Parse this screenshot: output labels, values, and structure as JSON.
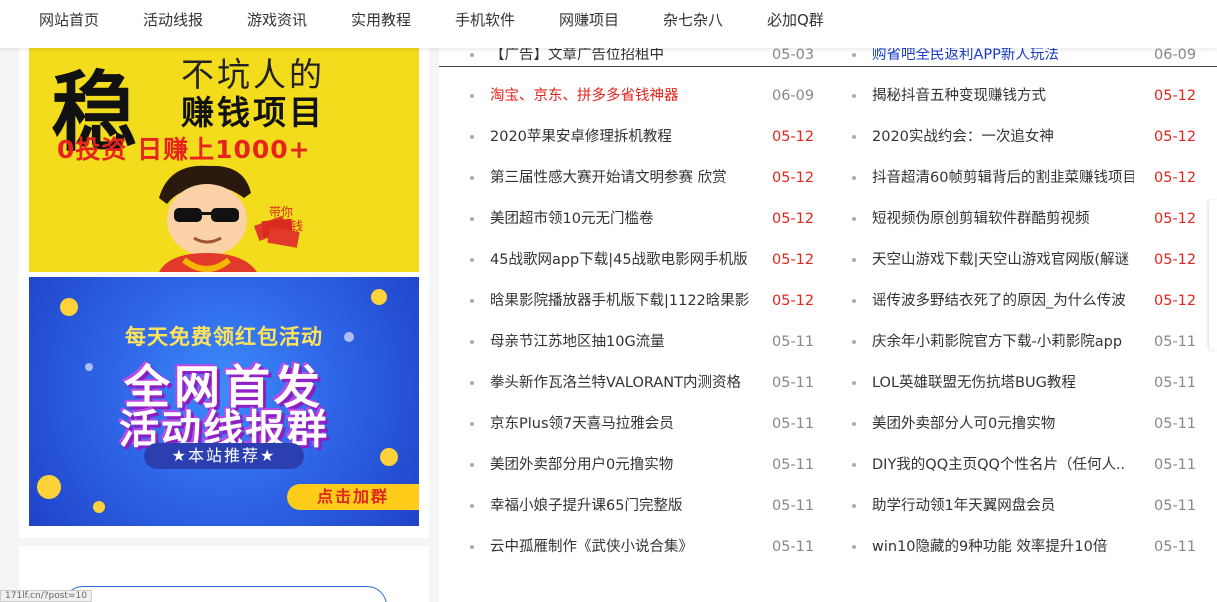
{
  "nav": {
    "items": [
      "网站首页",
      "活动线报",
      "游戏资讯",
      "实用教程",
      "手机软件",
      "网赚项目",
      "杂七杂八",
      "必加Q群"
    ]
  },
  "banner1": {
    "big_char": "稳",
    "line1": "不坑人的",
    "line2": "赚钱项目",
    "line3": "0投资 日赚上1000+"
  },
  "banner2": {
    "subtitle": "每天免费领红包活动",
    "title1": "全网首发",
    "title2": "活动线报群",
    "recommend": "★本站推荐★",
    "join": "点击加群"
  },
  "status_url": "171lf.cn/?post=10",
  "articles_left": [
    {
      "title": "【广告】文章广告位招租中",
      "date": "05-03",
      "title_color": "normal",
      "date_hot": false
    },
    {
      "title": "淘宝、京东、拼多多省钱神器",
      "date": "06-09",
      "title_color": "red",
      "date_hot": false
    },
    {
      "title": "2020苹果安卓修理拆机教程",
      "date": "05-12",
      "title_color": "normal",
      "date_hot": true
    },
    {
      "title": "第三届性感大赛开始请文明参赛 欣赏",
      "date": "05-12",
      "title_color": "normal",
      "date_hot": true
    },
    {
      "title": "美团超市领10元无门槛卷",
      "date": "05-12",
      "title_color": "normal",
      "date_hot": true
    },
    {
      "title": "45战歌网app下载|45战歌电影网手机版",
      "date": "05-12",
      "title_color": "normal",
      "date_hot": true
    },
    {
      "title": "晗果影院播放器手机版下载|1122晗果影",
      "date": "05-12",
      "title_color": "normal",
      "date_hot": true
    },
    {
      "title": "母亲节江苏地区抽10G流量",
      "date": "05-11",
      "title_color": "normal",
      "date_hot": false
    },
    {
      "title": "拳头新作瓦洛兰特VALORANT内测资格",
      "date": "05-11",
      "title_color": "normal",
      "date_hot": false
    },
    {
      "title": "京东Plus领7天喜马拉雅会员",
      "date": "05-11",
      "title_color": "normal",
      "date_hot": false
    },
    {
      "title": "美团外卖部分用户0元撸实物",
      "date": "05-11",
      "title_color": "normal",
      "date_hot": false
    },
    {
      "title": "幸福小娘子提升课65门完整版",
      "date": "05-11",
      "title_color": "normal",
      "date_hot": false
    },
    {
      "title": "云中孤雁制作《武侠小说合集》",
      "date": "05-11",
      "title_color": "normal",
      "date_hot": false
    }
  ],
  "articles_right": [
    {
      "title": "购省吧全民返利APP新人玩法",
      "date": "06-09",
      "title_color": "blue",
      "date_hot": false
    },
    {
      "title": "揭秘抖音五种变现赚钱方式",
      "date": "05-12",
      "title_color": "normal",
      "date_hot": true
    },
    {
      "title": "2020实战约会：一次追女神",
      "date": "05-12",
      "title_color": "normal",
      "date_hot": true
    },
    {
      "title": "抖音超清60帧剪辑背后的割韭菜赚钱项目",
      "date": "05-12",
      "title_color": "normal",
      "date_hot": true
    },
    {
      "title": "短视频伪原创剪辑软件群酷剪视频",
      "date": "05-12",
      "title_color": "normal",
      "date_hot": true
    },
    {
      "title": "天空山游戏下载|天空山游戏官网版(解谜",
      "date": "05-12",
      "title_color": "normal",
      "date_hot": true
    },
    {
      "title": "谣传波多野结衣死了的原因_为什么传波",
      "date": "05-12",
      "title_color": "normal",
      "date_hot": true
    },
    {
      "title": "庆余年小莉影院官方下载-小莉影院app",
      "date": "05-11",
      "title_color": "normal",
      "date_hot": false
    },
    {
      "title": "LOL英雄联盟无伤抗塔BUG教程",
      "date": "05-11",
      "title_color": "normal",
      "date_hot": false
    },
    {
      "title": "美团外卖部分人可0元撸实物",
      "date": "05-11",
      "title_color": "normal",
      "date_hot": false
    },
    {
      "title": "DIY我的QQ主页QQ个性名片（任何人..",
      "date": "05-11",
      "title_color": "normal",
      "date_hot": false
    },
    {
      "title": "助学行动领1年天翼网盘会员",
      "date": "05-11",
      "title_color": "normal",
      "date_hot": false
    },
    {
      "title": "win10隐藏的9种功能 效率提升10倍",
      "date": "05-11",
      "title_color": "normal",
      "date_hot": false
    }
  ]
}
